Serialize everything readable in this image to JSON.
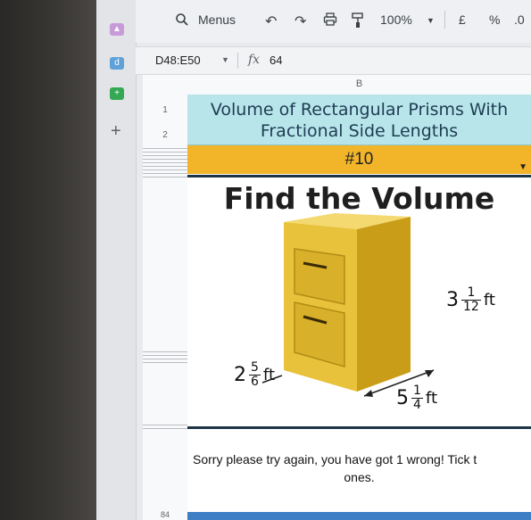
{
  "toolbar": {
    "search_label": "Menus",
    "zoom": "100%",
    "currency": "£",
    "percent": "%",
    "decimal": ".0"
  },
  "formula_bar": {
    "name_box": "D48:E50",
    "fx_symbol": "fx",
    "value": "64"
  },
  "grid": {
    "column_b": "B",
    "row_1": "1",
    "row_2": "2",
    "row_bottom": "84"
  },
  "worksheet": {
    "title_line1": "Volume of Rectangular Prisms With",
    "title_line2": "Fractional Side Lengths",
    "problem_number": "#10",
    "heading": "Find the Volume",
    "height": {
      "whole": "3",
      "numerator": "1",
      "denominator": "12",
      "unit": "ft"
    },
    "width": {
      "whole": "2",
      "numerator": "5",
      "denominator": "6",
      "unit": "ft"
    },
    "length": {
      "whole": "5",
      "numerator": "1",
      "denominator": "4",
      "unit": "ft"
    },
    "feedback_line1": "Sorry please try again, you have got 1 wrong! Tick t",
    "feedback_line2": "ones."
  },
  "colors": {
    "title_bg": "#b7e5ea",
    "number_bg": "#f2b52a",
    "cabinet": "#e8c23a"
  },
  "icons": [
    "search-icon",
    "undo-icon",
    "redo-icon",
    "print-icon",
    "paint-format-icon",
    "add-icon"
  ]
}
